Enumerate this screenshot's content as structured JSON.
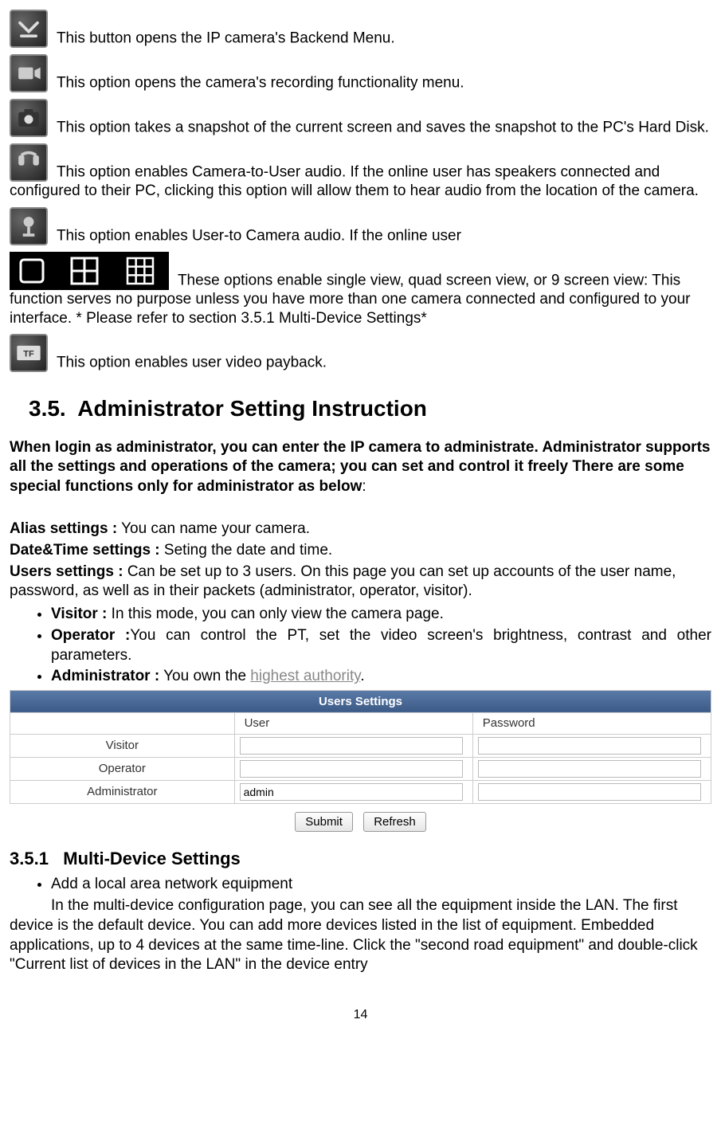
{
  "icons": {
    "backend": "This button opens the IP camera's Backend Menu.",
    "recording": "This option opens the camera's recording functionality menu.",
    "snapshot": "This option takes a snapshot of the current screen and saves the snapshot to the PC's Hard Disk.",
    "audio_cam2user": "This option enables Camera-to-User audio. If the online user has speakers connected and configured to their PC, clicking this option will allow them to hear audio from the location of the camera.",
    "audio_user2cam": "This option enables User-to Camera audio. If the online user",
    "views": "These options enable single view, quad screen view, or 9 screen view: This function serves no purpose unless you have more than one camera connected and configured to your interface. * Please refer to section 3.5.1 Multi-Device Settings*",
    "payback": "This option enables user  video payback."
  },
  "section": {
    "number": "3.5.",
    "title": "Administrator Setting Instruction",
    "intro": "When login as administrator, you can enter the IP camera to administrate. Administrator supports all the settings and operations of the camera; you can set and control it freely There are some special functions only for administrator as below",
    "alias_label": "Alias settings :",
    "alias_text": " You can name your camera.",
    "datetime_label": "Date&Time settings :",
    "datetime_text": " Seting the date and time.",
    "users_label": "Users settings :",
    "users_text": " Can be set up to 3 users. On this page you can set up accounts of the user name, password, as well as in their packets (administrator, operator, visitor).",
    "roles": {
      "visitor_label": "Visitor :",
      "visitor_text": " In this mode, you can only view the camera page.",
      "operator_label": "Operator :",
      "operator_text": "You can control the PT, set the video screen's brightness, contrast and other parameters.",
      "admin_label": "Administrator :",
      "admin_text": " You own the ",
      "admin_highest": "highest authority"
    }
  },
  "users_table": {
    "title": "Users Settings",
    "col_user": "User",
    "col_password": "Password",
    "rows": [
      {
        "role": "Visitor",
        "user": "",
        "password": ""
      },
      {
        "role": "Operator",
        "user": "",
        "password": ""
      },
      {
        "role": "Administrator",
        "user": "admin",
        "password": ""
      }
    ],
    "submit": "Submit",
    "refresh": "Refresh"
  },
  "subsection": {
    "number": "3.5.1",
    "title": "Multi-Device Settings",
    "bullet": "Add a local area network equipment",
    "body1": "In the multi-device configuration page, you can see all the equipment inside the LAN. The first device is the default device. You can add more devices listed in the list of equipment. Embedded applications, up to 4 devices at the same time-line. Click the \"second road equipment\" and double-click \"Current list of devices in the LAN\" in the device entry"
  },
  "page_number": "14"
}
